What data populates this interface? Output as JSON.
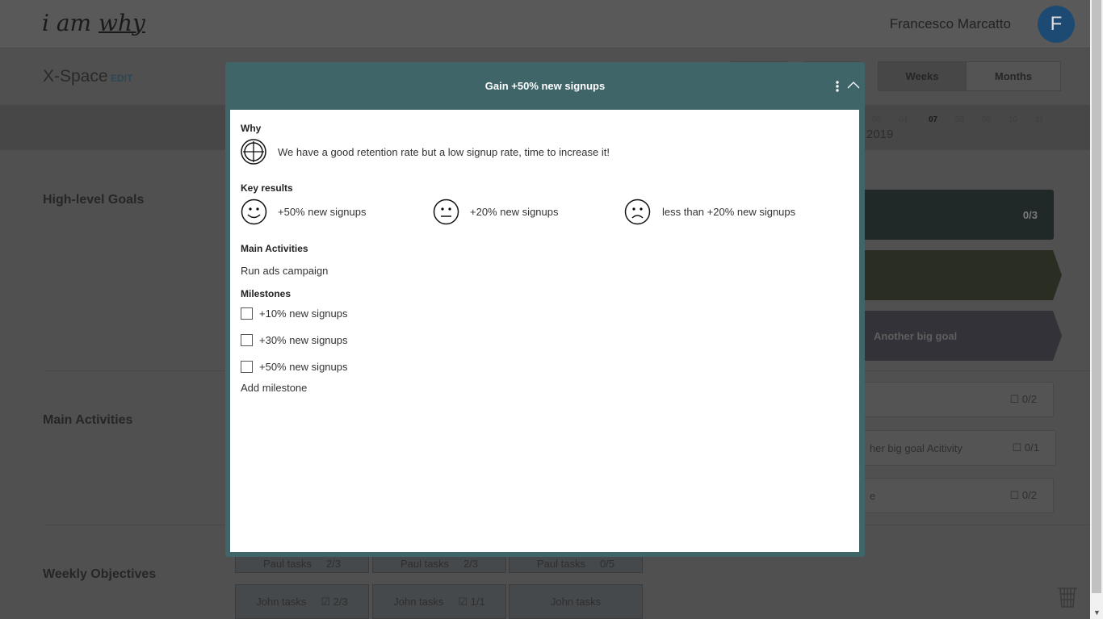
{
  "header": {
    "logo": "i am why",
    "user_name": "Francesco Marcatto",
    "avatar_initial": "F",
    "avatar_color": "#2a6fb5"
  },
  "subheader": {
    "space_name": "X-Space",
    "edit_label": "EDIT",
    "toggle": {
      "weeks": "Weeks",
      "months": "Months",
      "selected": "Weeks"
    }
  },
  "timeline": {
    "weeks": [
      "03",
      "04",
      "07",
      "08",
      "09",
      "10",
      "11"
    ],
    "current_week": "07",
    "year": "2019"
  },
  "rows": {
    "goals": "High-level Goals",
    "activities": "Main Activities",
    "objectives": "Weekly Objectives"
  },
  "goals": [
    {
      "label": "",
      "count": "0/3",
      "color": "#5c7373"
    },
    {
      "label": "",
      "count": "",
      "color": "#788161"
    },
    {
      "label": "Another big goal",
      "count": "",
      "color": "#918fa0"
    }
  ],
  "activities": [
    {
      "label": "",
      "count": "0/2"
    },
    {
      "label": "her big goal Acitivity",
      "count": "0/1"
    },
    {
      "label": "e",
      "count": "0/2"
    }
  ],
  "weekly_objectives": [
    [
      {
        "label": "Paul tasks",
        "count": "2/3"
      },
      {
        "label": "Paul tasks",
        "count": "2/3"
      },
      {
        "label": "Paul tasks",
        "count": "0/5"
      }
    ],
    [
      {
        "label": "John tasks",
        "count": "2/3"
      },
      {
        "label": "John tasks",
        "count": "1/1"
      },
      {
        "label": "John tasks",
        "count": ""
      }
    ]
  ],
  "modal": {
    "title": "Gain +50% new signups",
    "accent": "#3f6569",
    "why_label": "Why",
    "why_text": "We have a good retention rate but a low signup rate, time to increase it!",
    "key_results_label": "Key results",
    "key_results": [
      {
        "icon": "smile-icon",
        "text": "+50% new signups"
      },
      {
        "icon": "neutral-face-icon",
        "text": "+20% new signups"
      },
      {
        "icon": "sad-face-icon",
        "text": "less than +20% new signups"
      }
    ],
    "activities_label": "Main Activities",
    "activities": [
      "Run ads campaign"
    ],
    "milestones_label": "Milestones",
    "milestones": [
      {
        "text": "+10% new signups",
        "checked": false
      },
      {
        "text": "+30% new signups",
        "checked": false
      },
      {
        "text": "+50% new signups",
        "checked": false
      }
    ],
    "add_milestone": "Add milestone"
  }
}
